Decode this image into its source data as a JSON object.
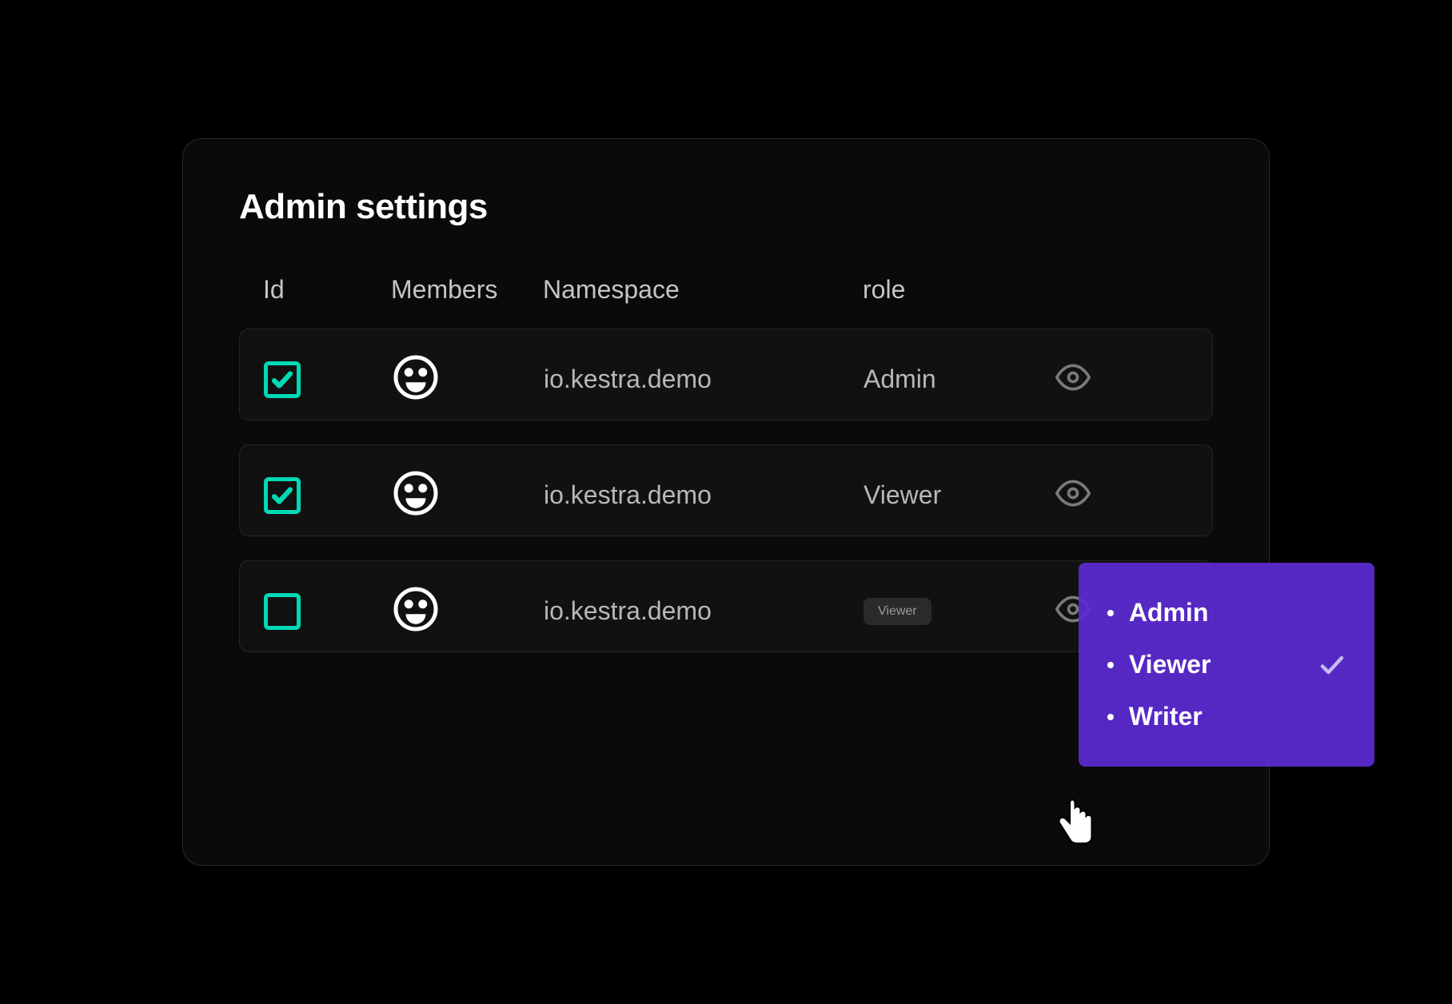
{
  "title": "Admin settings",
  "columns": {
    "id": "Id",
    "members": "Members",
    "namespace": "Namespace",
    "role": "role"
  },
  "rows": [
    {
      "checked": true,
      "namespace": "io.kestra.demo",
      "role": "Admin",
      "highlighted": false
    },
    {
      "checked": true,
      "namespace": "io.kestra.demo",
      "role": "Viewer",
      "highlighted": false
    },
    {
      "checked": false,
      "namespace": "io.kestra.demo",
      "role": "Viewer",
      "highlighted": true
    }
  ],
  "dropdown": {
    "options": [
      {
        "label": "Admin",
        "selected": false
      },
      {
        "label": "Viewer",
        "selected": true
      },
      {
        "label": "Writer",
        "selected": false
      }
    ]
  }
}
